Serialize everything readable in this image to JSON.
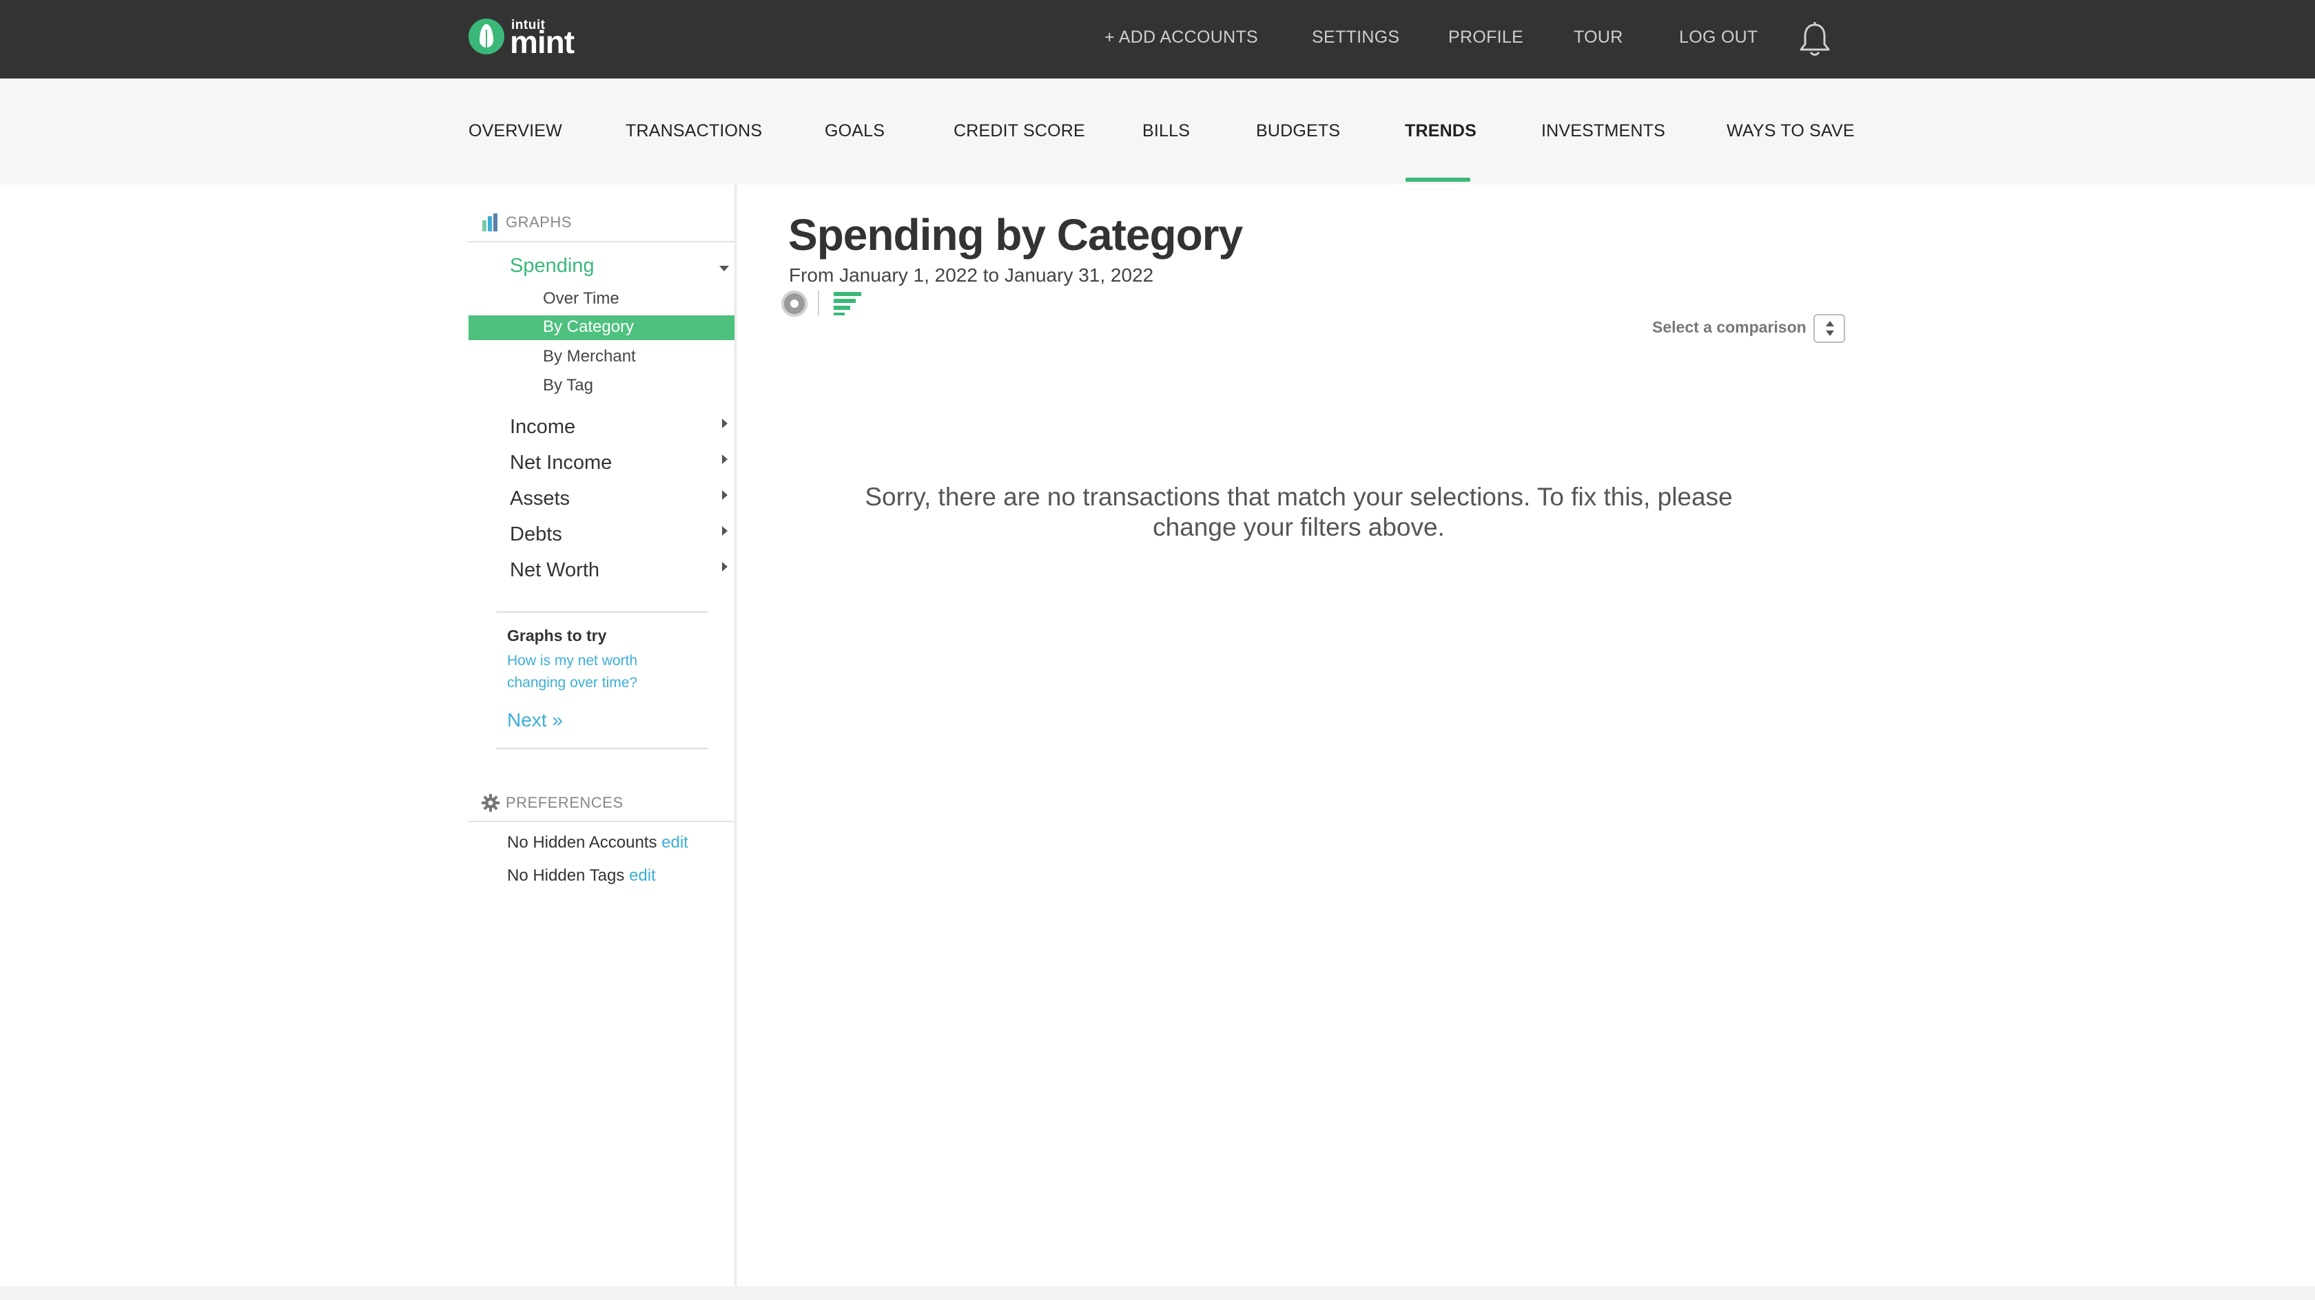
{
  "brand": {
    "top": "intuit",
    "name": "mint"
  },
  "top_nav": {
    "add_accounts": "+ ADD ACCOUNTS",
    "settings": "SETTINGS",
    "profile": "PROFILE",
    "tour": "TOUR",
    "log_out": "LOG OUT"
  },
  "main_nav": {
    "overview": "OVERVIEW",
    "transactions": "TRANSACTIONS",
    "goals": "GOALS",
    "credit_score": "CREDIT SCORE",
    "bills": "BILLS",
    "budgets": "BUDGETS",
    "trends": "TRENDS",
    "investments": "INVESTMENTS",
    "ways_to_save": "WAYS TO SAVE",
    "active": "TRENDS"
  },
  "sidebar": {
    "graphs_heading": "GRAPHS",
    "spending": "Spending",
    "spending_sub": {
      "over_time": "Over Time",
      "by_category": "By Category",
      "by_merchant": "By Merchant",
      "by_tag": "By Tag"
    },
    "income": "Income",
    "net_income": "Net Income",
    "assets": "Assets",
    "debts": "Debts",
    "net_worth": "Net Worth",
    "graphs_to_try": {
      "title": "Graphs to try",
      "link": "How is my net worth changing over time?",
      "next": "Next »"
    },
    "preferences_heading": "PREFERENCES",
    "hidden_accounts": "No Hidden Accounts",
    "hidden_tags": "No Hidden Tags",
    "edit_label": "edit"
  },
  "content": {
    "title": "Spending by Category",
    "date_range": "From January 1, 2022 to January 31, 2022",
    "compare_label": "Select a comparison",
    "empty_message": "Sorry, there are no transactions that match your selections. To fix this, please change your filters above."
  },
  "colors": {
    "topbar": "#333333",
    "accent_green": "#3bb878",
    "link_blue": "#3bafd6"
  },
  "icons": {
    "bell": "bell-icon",
    "graphs": "bar-chart-icon",
    "preferences": "gear-icon",
    "pie_view": "pie-chart-icon",
    "bar_view": "bar-list-icon"
  }
}
